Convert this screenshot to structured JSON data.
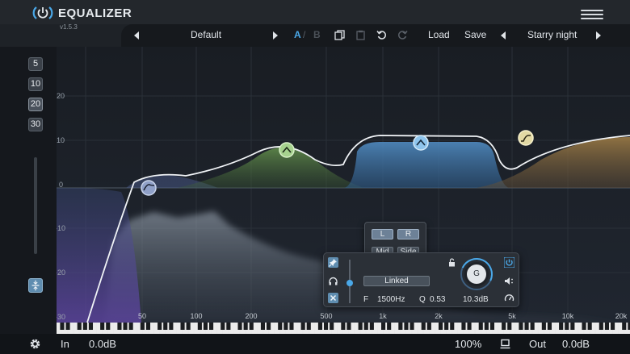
{
  "app": {
    "title": "EQUALIZER",
    "version": "v1.5.3"
  },
  "toolbar": {
    "preset_name": "Default",
    "ab_a": "A",
    "ab_sep": "/",
    "ab_b": "B",
    "load_label": "Load",
    "save_label": "Save",
    "theme_name": "Starry night"
  },
  "zoom": {
    "levels": [
      "5",
      "10",
      "20",
      "30"
    ],
    "selected": "20"
  },
  "graph": {
    "db_labels": [
      "20",
      "10",
      "0",
      "-10",
      "-20",
      "-30"
    ],
    "freq_labels": [
      "50",
      "100",
      "200",
      "500",
      "1k",
      "2k",
      "5k",
      "10k",
      "20k"
    ]
  },
  "band_panel": {
    "channel_left": "L",
    "channel_right": "R",
    "channel_mid": "Mid",
    "channel_side": "Side",
    "link_label": "Linked",
    "freq_label": "F",
    "freq_value": "1500Hz",
    "q_label": "Q",
    "q_value": "0.53",
    "gain_knob_label": "G",
    "gain_value": "10.3dB"
  },
  "footer": {
    "in_label": "In",
    "in_value": "0.0dB",
    "zoom_percent": "100%",
    "out_label": "Out",
    "out_value": "0.0dB"
  },
  "colors": {
    "accent_blue": "#4aa8e8",
    "band1": "#8fa0c8",
    "band2": "#7fb070",
    "band3": "#6fb0e0",
    "band4": "#d8c890"
  }
}
